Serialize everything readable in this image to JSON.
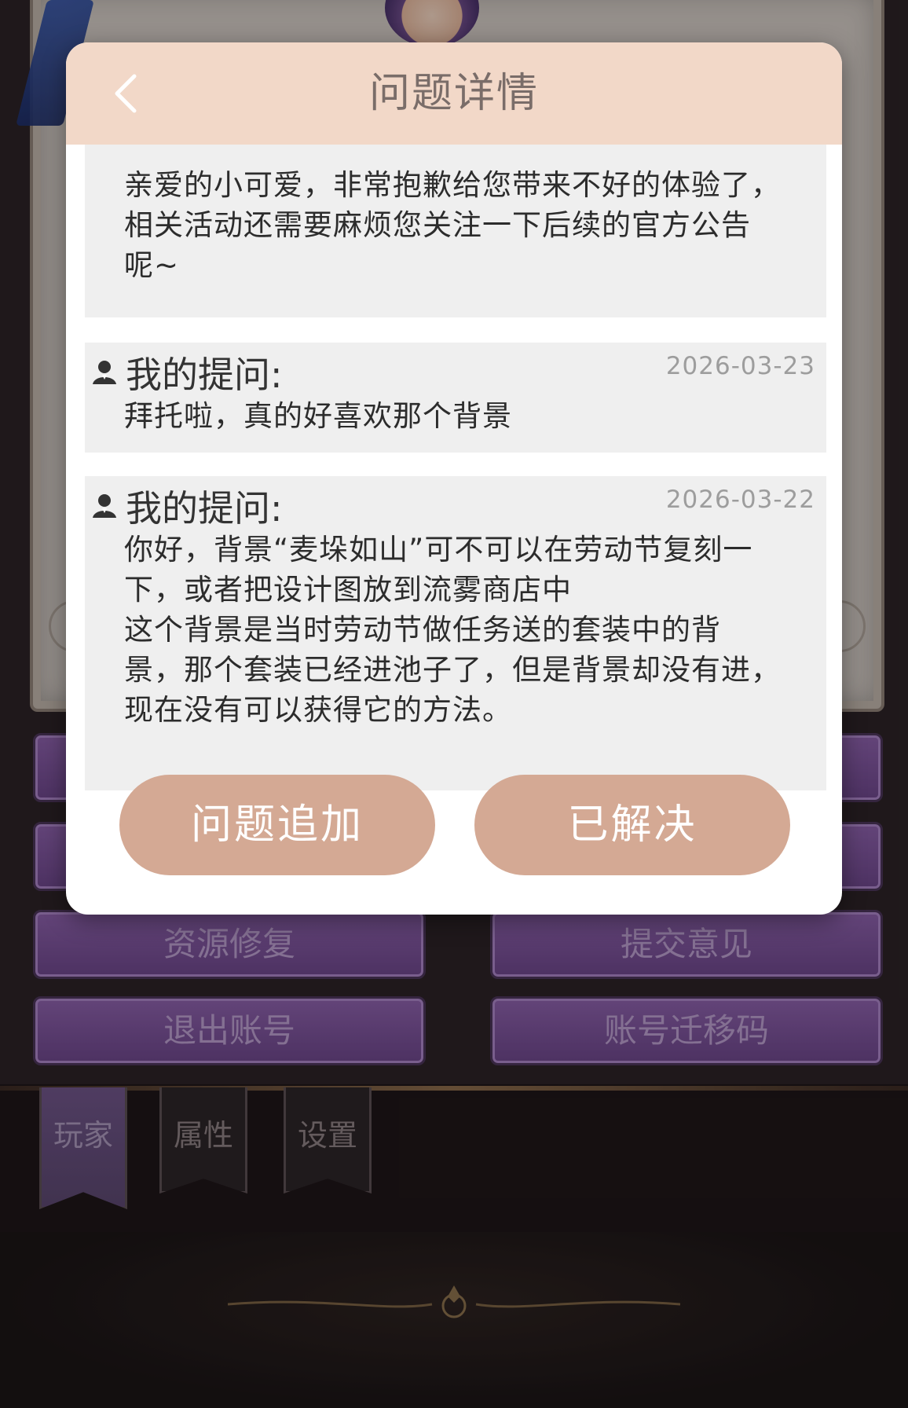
{
  "background": {
    "buttons": [
      {
        "label": "资源修复"
      },
      {
        "label": "提交意见"
      },
      {
        "label": "退出账号"
      },
      {
        "label": "账号迁移码"
      }
    ],
    "tabs": [
      {
        "label": "玩家",
        "active": true
      },
      {
        "label": "属性",
        "active": false
      },
      {
        "label": "设置",
        "active": false
      }
    ]
  },
  "dialog": {
    "title": "问题详情",
    "reply": {
      "text": "亲爱的小可爱，非常抱歉给您带来不好的体验了，\n相关活动还需要麻烦您关注一下后续的官方公告\n呢~"
    },
    "questions": [
      {
        "label": "我的提问:",
        "date": "2026-03-23",
        "text": "拜托啦，真的好喜欢那个背景"
      },
      {
        "label": "我的提问:",
        "date": "2026-03-22",
        "text": "你好，背景“麦垛如山”可不可以在劳动节复刻一\n下，或者把设计图放到流雾商店中\n这个背景是当时劳动节做任务送的套装中的背\n景，那个套装已经进池子了，但是背景却没有进，\n现在没有可以获得它的方法。"
      }
    ],
    "buttons": {
      "add_question": "问题追加",
      "resolved": "已解决"
    }
  },
  "colors": {
    "header_bg": "#f2d8c8",
    "button_bg": "#d4a994",
    "card_bg": "#efefef"
  }
}
